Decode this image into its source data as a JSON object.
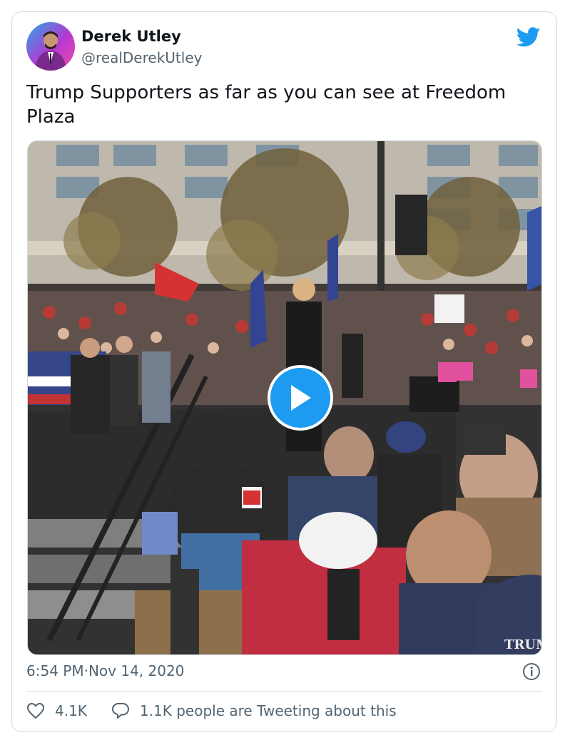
{
  "author": {
    "name": "Derek Utley",
    "handle": "@realDerekUtley"
  },
  "tweet": {
    "text": "Trump Supporters as far as you can see at Freedom Plaza"
  },
  "media": {
    "type": "video",
    "sign_label": "TRUMP"
  },
  "meta": {
    "time": "6:54 PM",
    "separator": " · ",
    "date": "Nov 14, 2020"
  },
  "actions": {
    "likes": "4.1K",
    "tweeting": "1.1K people are Tweeting about this"
  },
  "icons": {
    "platform": "twitter-bird-icon",
    "play": "play-icon",
    "info": "info-icon",
    "like": "heart-icon",
    "reply": "speech-bubble-icon"
  },
  "colors": {
    "accent": "#1d9bf0",
    "secondary_text": "#536471",
    "border": "#cfd9de"
  }
}
